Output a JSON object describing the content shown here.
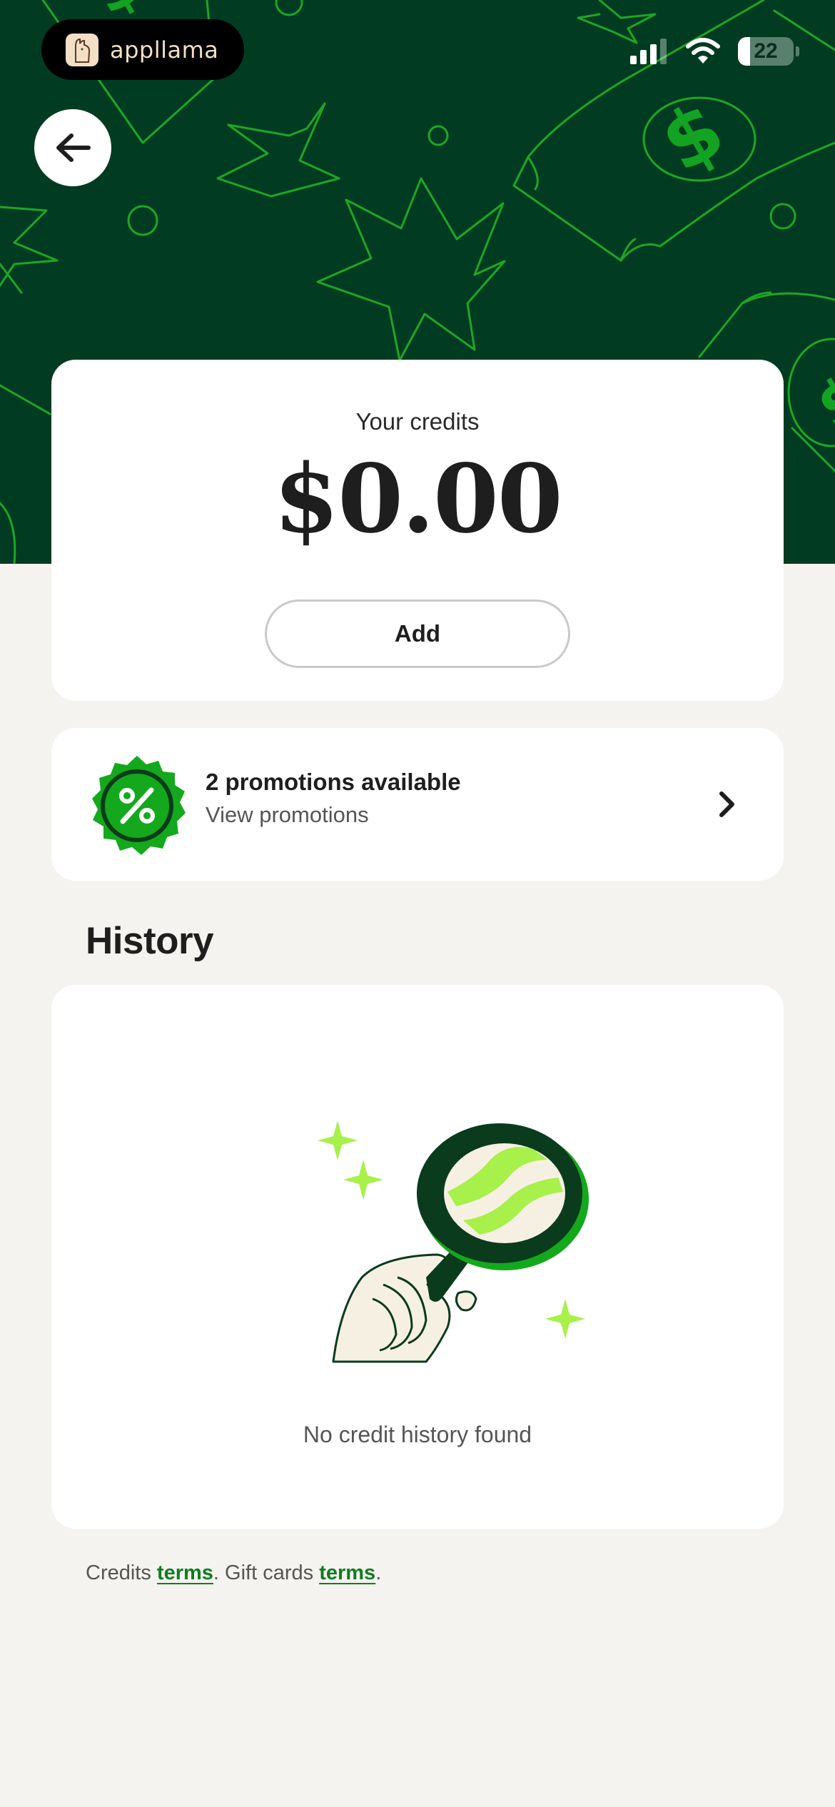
{
  "app": {
    "name": "appllama"
  },
  "status_bar": {
    "battery_level": "22"
  },
  "credits": {
    "label": "Your credits",
    "amount": "$0.00",
    "add_label": "Add"
  },
  "promotions": {
    "title": "2 promotions available",
    "subtitle": "View promotions"
  },
  "history": {
    "heading": "History",
    "empty_text": "No credit history found"
  },
  "footer": {
    "credits_prefix": "Credits ",
    "credits_link": "terms",
    "middle": ". Gift cards ",
    "gift_link": "terms",
    "suffix": "."
  },
  "colors": {
    "hero_bg": "#003B22",
    "accent_green": "#18B21C",
    "lime": "#A8F04A",
    "page_bg": "#F4F3EF"
  },
  "icons": [
    "back-arrow-icon",
    "percent-badge-icon",
    "chevron-right-icon",
    "magnifier-illustration",
    "signal-icon",
    "wifi-icon",
    "battery-icon"
  ]
}
